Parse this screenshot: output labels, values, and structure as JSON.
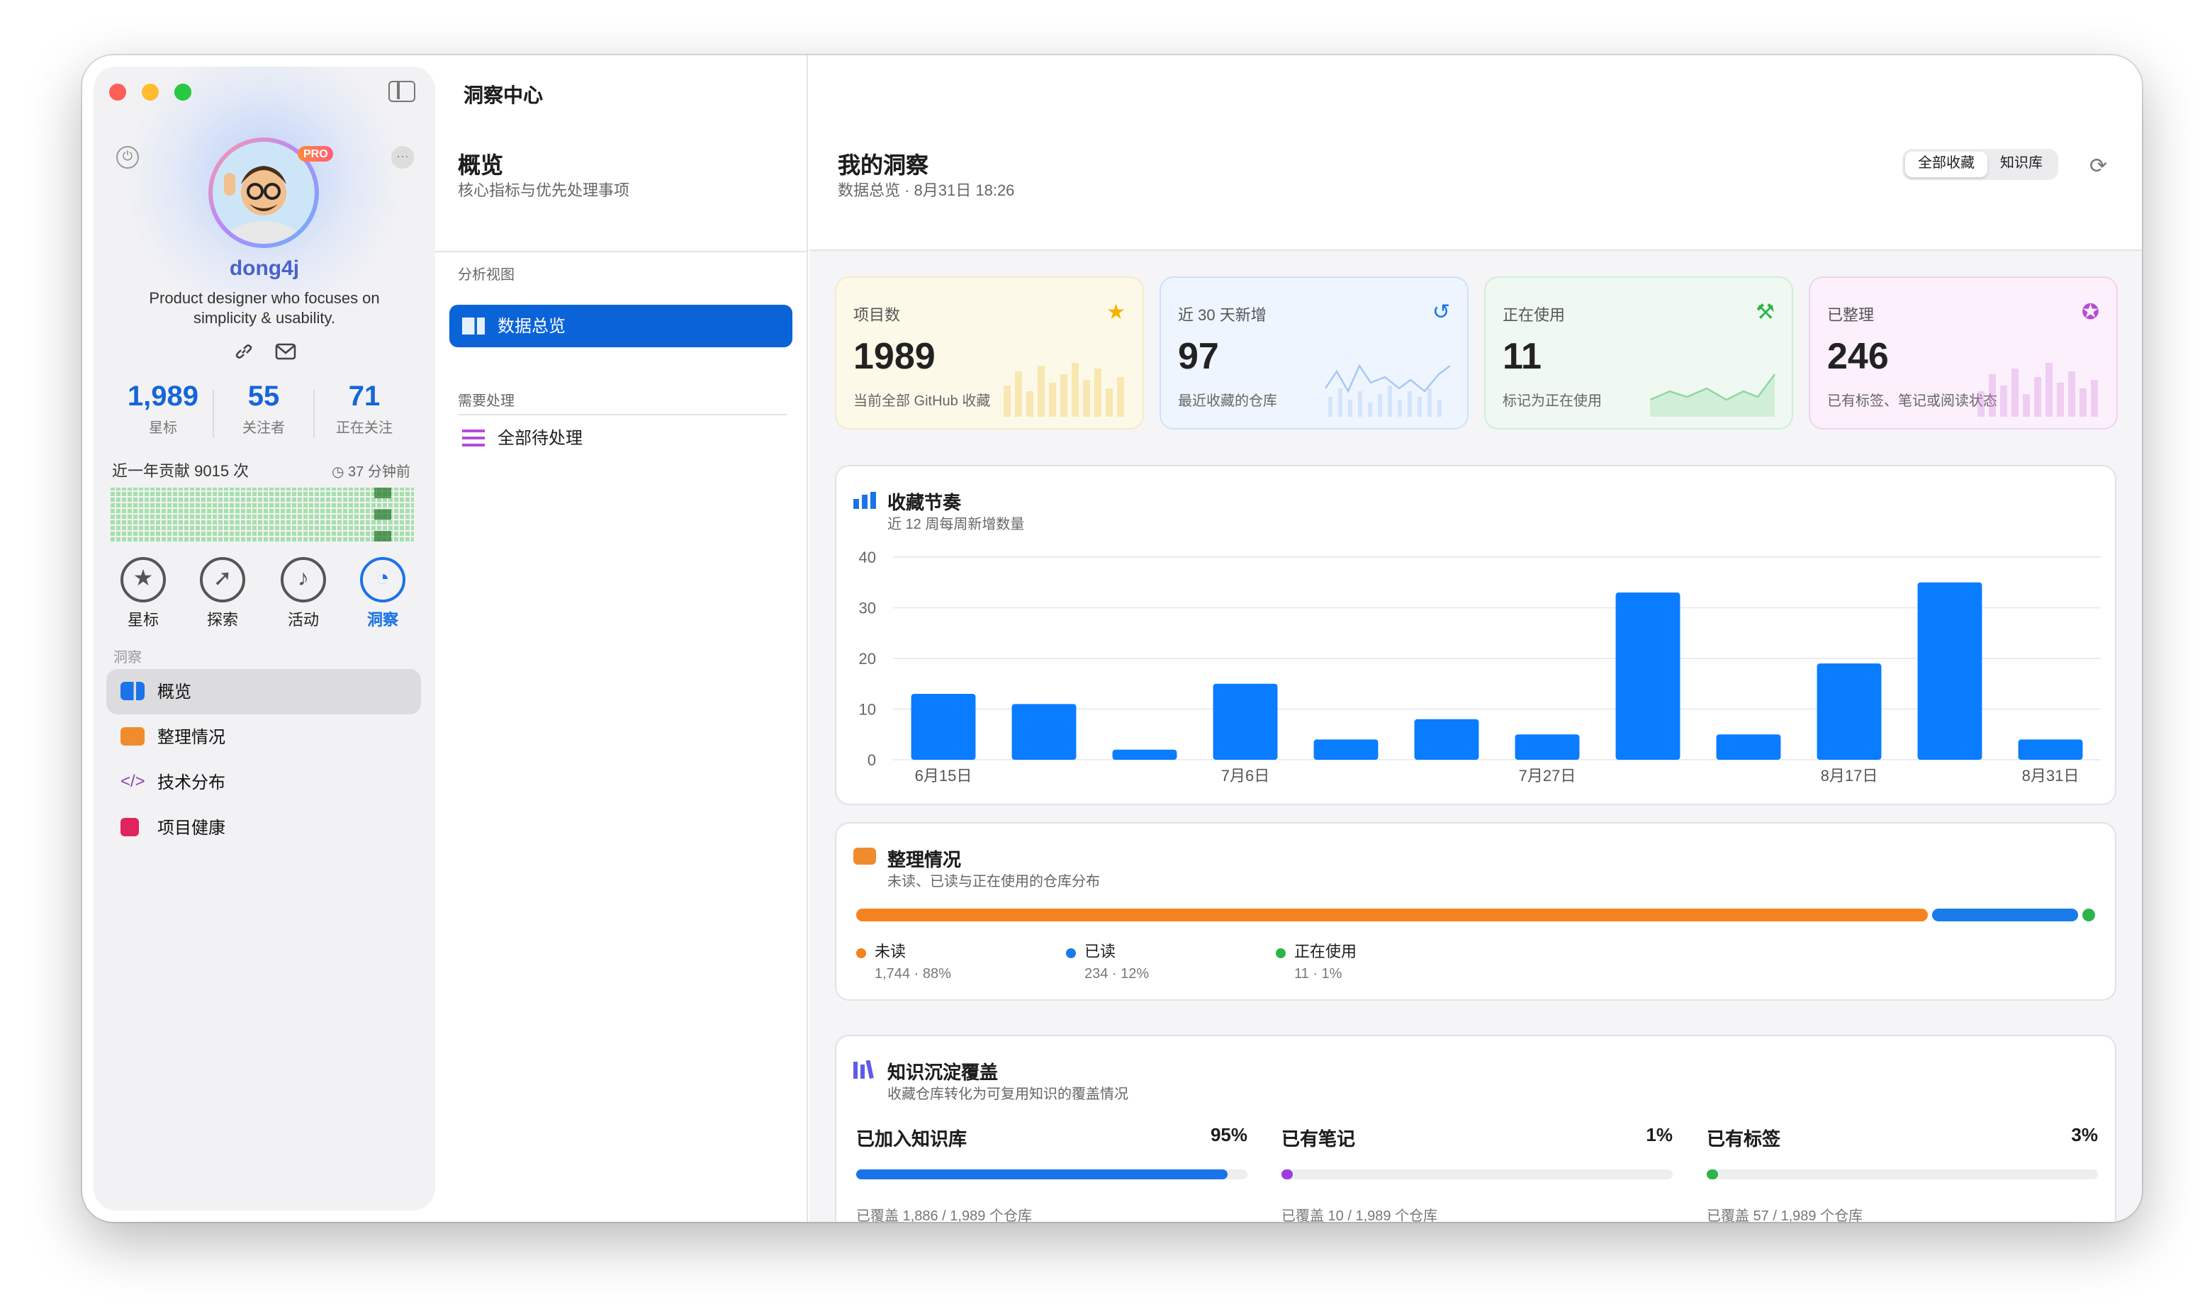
{
  "sidebar": {
    "username": "dong4j",
    "badge": "PRO",
    "bio": "Product designer who focuses on simplicity & usability.",
    "stats": [
      {
        "value": "1,989",
        "label": "星标"
      },
      {
        "value": "55",
        "label": "关注者"
      },
      {
        "value": "71",
        "label": "正在关注"
      }
    ],
    "contrib_label": "近一年贡献 9015 次",
    "contrib_time": "37 分钟前",
    "quick_actions": [
      {
        "label": "星标",
        "icon": "star-icon"
      },
      {
        "label": "探索",
        "icon": "compass-icon"
      },
      {
        "label": "活动",
        "icon": "bell-icon"
      },
      {
        "label": "洞察",
        "icon": "gauge-icon"
      }
    ],
    "section_label": "洞察",
    "nav_items": [
      {
        "label": "概览",
        "icon": "overview-icon",
        "color": "#1a73e8",
        "selected": true
      },
      {
        "label": "整理情况",
        "icon": "tray-icon",
        "color": "#f08c2e"
      },
      {
        "label": "技术分布",
        "icon": "code-icon",
        "color": "#8e44ad"
      },
      {
        "label": "项目健康",
        "icon": "health-icon",
        "color": "#e0245e"
      }
    ]
  },
  "middle": {
    "app_title": "洞察中心",
    "heading": "概览",
    "subheading": "核心指标与优先处理事项",
    "group1": "分析视图",
    "item1": "数据总览",
    "group2": "需要处理",
    "item2": "全部待处理"
  },
  "main": {
    "title": "我的洞察",
    "subtitle": "数据总览 · 8月31日 18:26",
    "segment": [
      "全部收藏",
      "知识库"
    ],
    "cards": [
      {
        "label": "项目数",
        "value": "1989",
        "sub": "当前全部 GitHub 收藏",
        "icon": "star-icon",
        "accent": "#f5b400"
      },
      {
        "label": "近 30 天新增",
        "value": "97",
        "sub": "最近收藏的仓库",
        "icon": "history-icon",
        "accent": "#1a73e8"
      },
      {
        "label": "正在使用",
        "value": "11",
        "sub": "标记为正在使用",
        "icon": "hammer-icon",
        "accent": "#2bb54a"
      },
      {
        "label": "已整理",
        "value": "246",
        "sub": "已有标签、笔记或阅读状态",
        "icon": "check-badge-icon",
        "accent": "#b44bd6"
      }
    ],
    "rhythm": {
      "title": "收藏节奏",
      "subtitle": "近 12 周每周新增数量"
    },
    "organize": {
      "title": "整理情况",
      "subtitle": "未读、已读与正在使用的仓库分布",
      "parts": [
        {
          "label": "未读",
          "value": "1,744 · 88%",
          "pct": 88,
          "color": "#f5811f"
        },
        {
          "label": "已读",
          "value": "234 · 12%",
          "pct": 12,
          "color": "#1a7bea"
        },
        {
          "label": "正在使用",
          "value": "11 · 1%",
          "pct": 1,
          "color": "#2bb54a"
        }
      ]
    },
    "knowledge": {
      "title": "知识沉淀覆盖",
      "subtitle": "收藏仓库转化为可复用知识的覆盖情况",
      "items": [
        {
          "label": "已加入知识库",
          "pct_text": "95%",
          "pct": 95,
          "detail": "已覆盖 1,886 / 1,989 个仓库",
          "color": "#1a73e8"
        },
        {
          "label": "已有笔记",
          "pct_text": "1%",
          "pct": 1,
          "detail": "已覆盖 10 / 1,989 个仓库",
          "color": "#9b3de0"
        },
        {
          "label": "已有标签",
          "pct_text": "3%",
          "pct": 3,
          "detail": "已覆盖 57 / 1,989 个仓库",
          "color": "#2bb54a"
        }
      ]
    }
  },
  "chart_data": {
    "type": "bar",
    "title": "收藏节奏",
    "subtitle": "近 12 周每周新增数量",
    "categories": [
      "6月15日",
      "",
      "",
      "7月6日",
      "",
      "",
      "7月27日",
      "",
      "",
      "8月17日",
      "",
      "8月31日"
    ],
    "values": [
      13,
      11,
      2,
      15,
      4,
      8,
      5,
      33,
      5,
      19,
      35,
      4
    ],
    "ylim": [
      0,
      40
    ],
    "yticks": [
      0,
      10,
      20,
      30,
      40
    ],
    "grid": true,
    "color": "#0a7cff"
  }
}
